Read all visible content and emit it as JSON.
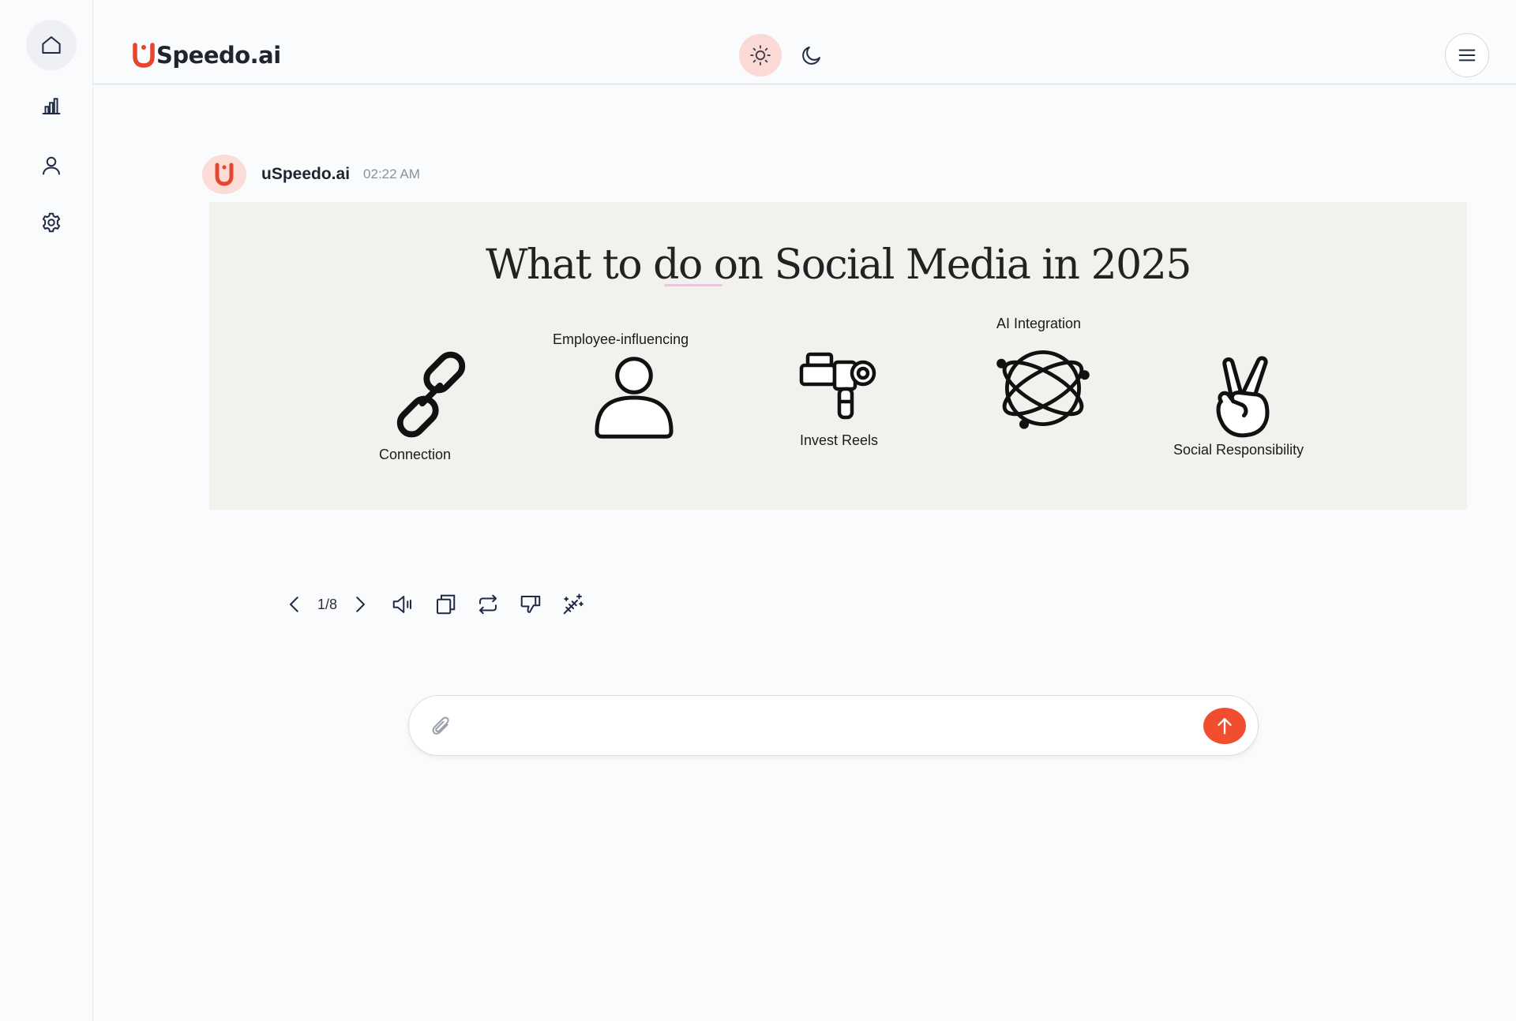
{
  "brand": {
    "logo_text": "Speedo.ai",
    "accent": "#e8452f"
  },
  "sidebar": {
    "items": [
      {
        "name": "home",
        "icon": "home-icon"
      },
      {
        "name": "analytics",
        "icon": "bar-chart-icon"
      },
      {
        "name": "profile",
        "icon": "user-icon"
      },
      {
        "name": "settings",
        "icon": "gear-icon"
      }
    ]
  },
  "header": {
    "light_theme_icon": "sun-icon",
    "dark_theme_icon": "moon-icon",
    "menu_icon": "hamburger-icon"
  },
  "message": {
    "sender": "uSpeedo.ai",
    "time": "02:22 AM",
    "slide": {
      "title": "What to do on Social Media in 2025",
      "items": [
        {
          "label": "Connection",
          "icon": "link-icon"
        },
        {
          "label": "Employee-influencing",
          "icon": "person-icon"
        },
        {
          "label": "Invest Reels",
          "icon": "camera-icon"
        },
        {
          "label": "AI Integration",
          "icon": "atom-icon"
        },
        {
          "label": "Social Responsibility",
          "icon": "peace-hand-icon"
        }
      ]
    }
  },
  "toolbar": {
    "pager": "1/8",
    "icons": [
      "chevron-left-icon",
      "chevron-right-icon",
      "speaker-icon",
      "copy-icon",
      "regenerate-icon",
      "thumbs-down-icon",
      "magic-wand-icon"
    ]
  },
  "composer": {
    "placeholder": "",
    "send_color": "#f04e2f"
  }
}
